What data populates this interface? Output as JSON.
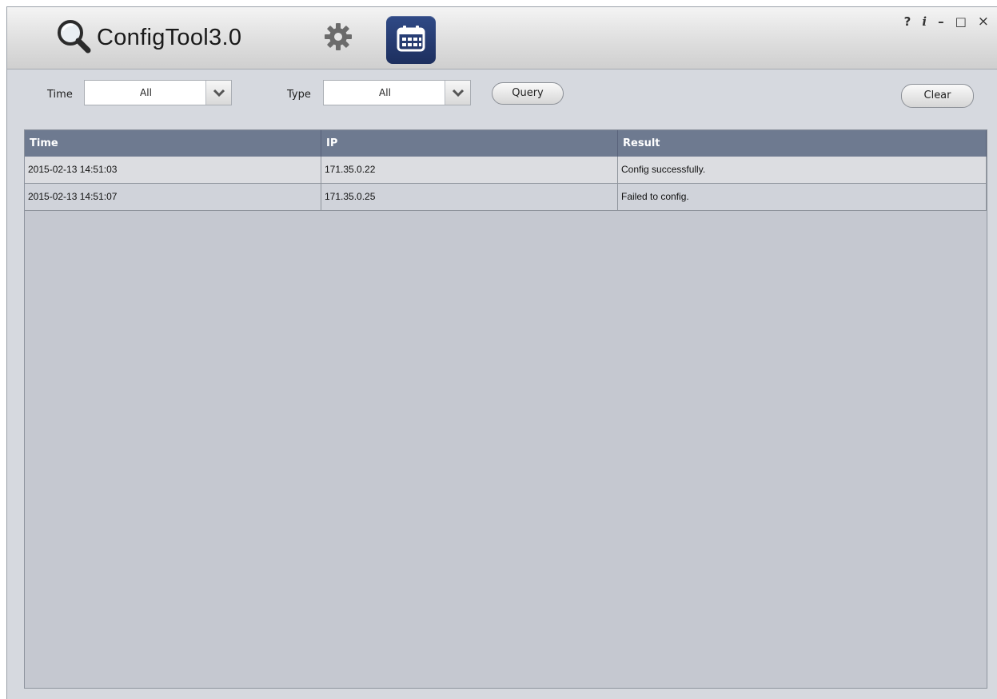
{
  "app": {
    "title": "ConfigTool3.0"
  },
  "window_controls": {
    "help": "?",
    "info": "i",
    "minimize": "–",
    "maximize": "□",
    "close": "×"
  },
  "toolbar": {
    "time_label": "Time",
    "time_value": "All",
    "type_label": "Type",
    "type_value": "All",
    "query_label": "Query",
    "clear_label": "Clear"
  },
  "table": {
    "headers": [
      "Time",
      "IP",
      "Result"
    ],
    "rows": [
      [
        "2015-02-13 14:51:03",
        "171.35.0.22",
        "Config successfully."
      ],
      [
        "2015-02-13 14:51:07",
        "171.35.0.25",
        "Failed to config."
      ]
    ]
  },
  "icons": [
    "magnifier-icon",
    "gear-icon",
    "calendar-icon",
    "chevron-down-icon"
  ],
  "colors": {
    "header_bg": "#6e7a90",
    "calendar_bg": "#243a70",
    "table_bg": "#c5c8d0"
  }
}
